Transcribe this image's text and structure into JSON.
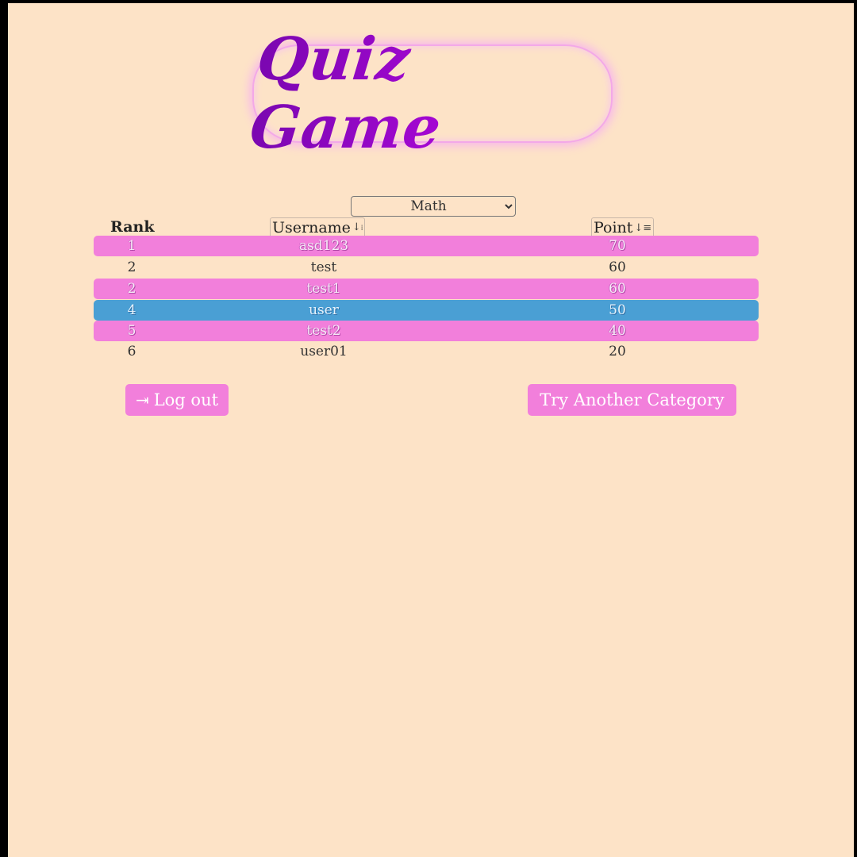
{
  "header": {
    "title": "Quiz Game"
  },
  "filter": {
    "selected": "Math"
  },
  "table": {
    "columns": {
      "rank": "Rank",
      "username": "Username",
      "point": "Point"
    },
    "rows": [
      {
        "rank": "1",
        "username": "asd123",
        "points": "70"
      },
      {
        "rank": "2",
        "username": "test",
        "points": "60"
      },
      {
        "rank": "2",
        "username": "test1",
        "points": "60"
      },
      {
        "rank": "4",
        "username": "user",
        "points": "50"
      },
      {
        "rank": "5",
        "username": "test2",
        "points": "40"
      },
      {
        "rank": "6",
        "username": "user01",
        "points": "20"
      }
    ],
    "row_styles": [
      "pink",
      "plain",
      "pink",
      "blue",
      "pink",
      "plain"
    ]
  },
  "actions": {
    "logout": "Log out",
    "try_another": "Try Another Category"
  },
  "colors": {
    "background": "#fde3c7",
    "pink": "#f27fdb",
    "blue": "#4a9fd4"
  }
}
